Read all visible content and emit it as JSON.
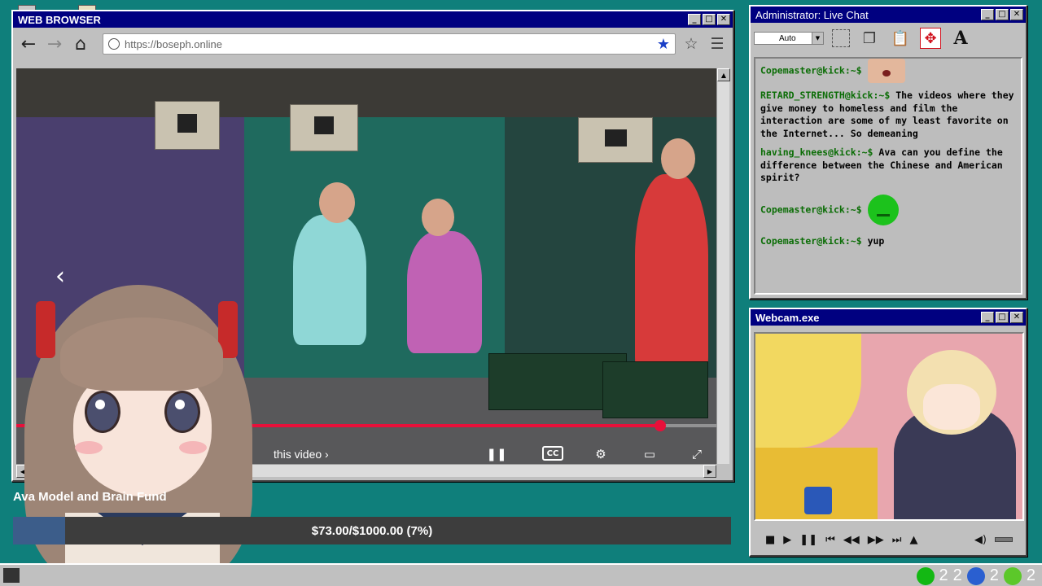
{
  "browser": {
    "title": "WEB BROWSER",
    "url": "https://boseph.online",
    "video": {
      "progress_fraction": 0.92,
      "label": "this video",
      "icons": [
        "prev-arrow-icon",
        "pause-icon",
        "closed-captions-icon",
        "settings-icon",
        "theater-mode-icon",
        "fullscreen-icon"
      ],
      "cc_label": "CC"
    }
  },
  "chat": {
    "title": "Administrator: Live Chat",
    "font_size_select": "Auto",
    "messages": [
      {
        "user": "Copemaster@kick:~$",
        "text": "",
        "emote": "face"
      },
      {
        "user": "RETARD_STRENGTH@kick:~$",
        "text": "The videos where they give money to homeless and film the interaction are some of my least favorite on the Internet... So demeaning",
        "emote": ""
      },
      {
        "user": "having_knees@kick:~$",
        "text": "Ava can you define the difference between the Chinese and American spirit?",
        "emote": ""
      },
      {
        "user": "Copemaster@kick:~$",
        "text": "",
        "emote": "sick"
      },
      {
        "user": "Copemaster@kick:~$",
        "text": "yup",
        "emote": ""
      }
    ]
  },
  "webcam": {
    "title": "Webcam.exe"
  },
  "fund": {
    "label": "Ava Model and Brain Fund",
    "amount_text": "$73.00/$1000.00 (7%)",
    "fraction": 0.073
  },
  "taskbar": {
    "tray": [
      "2",
      "2",
      "2",
      "2"
    ]
  },
  "colors": {
    "desktop": "#0f7f7b",
    "titlebar": "#000080",
    "chat_user": "#0b6d06",
    "progress_red": "#e8103a",
    "fund_fill": "#3c5d8a"
  }
}
